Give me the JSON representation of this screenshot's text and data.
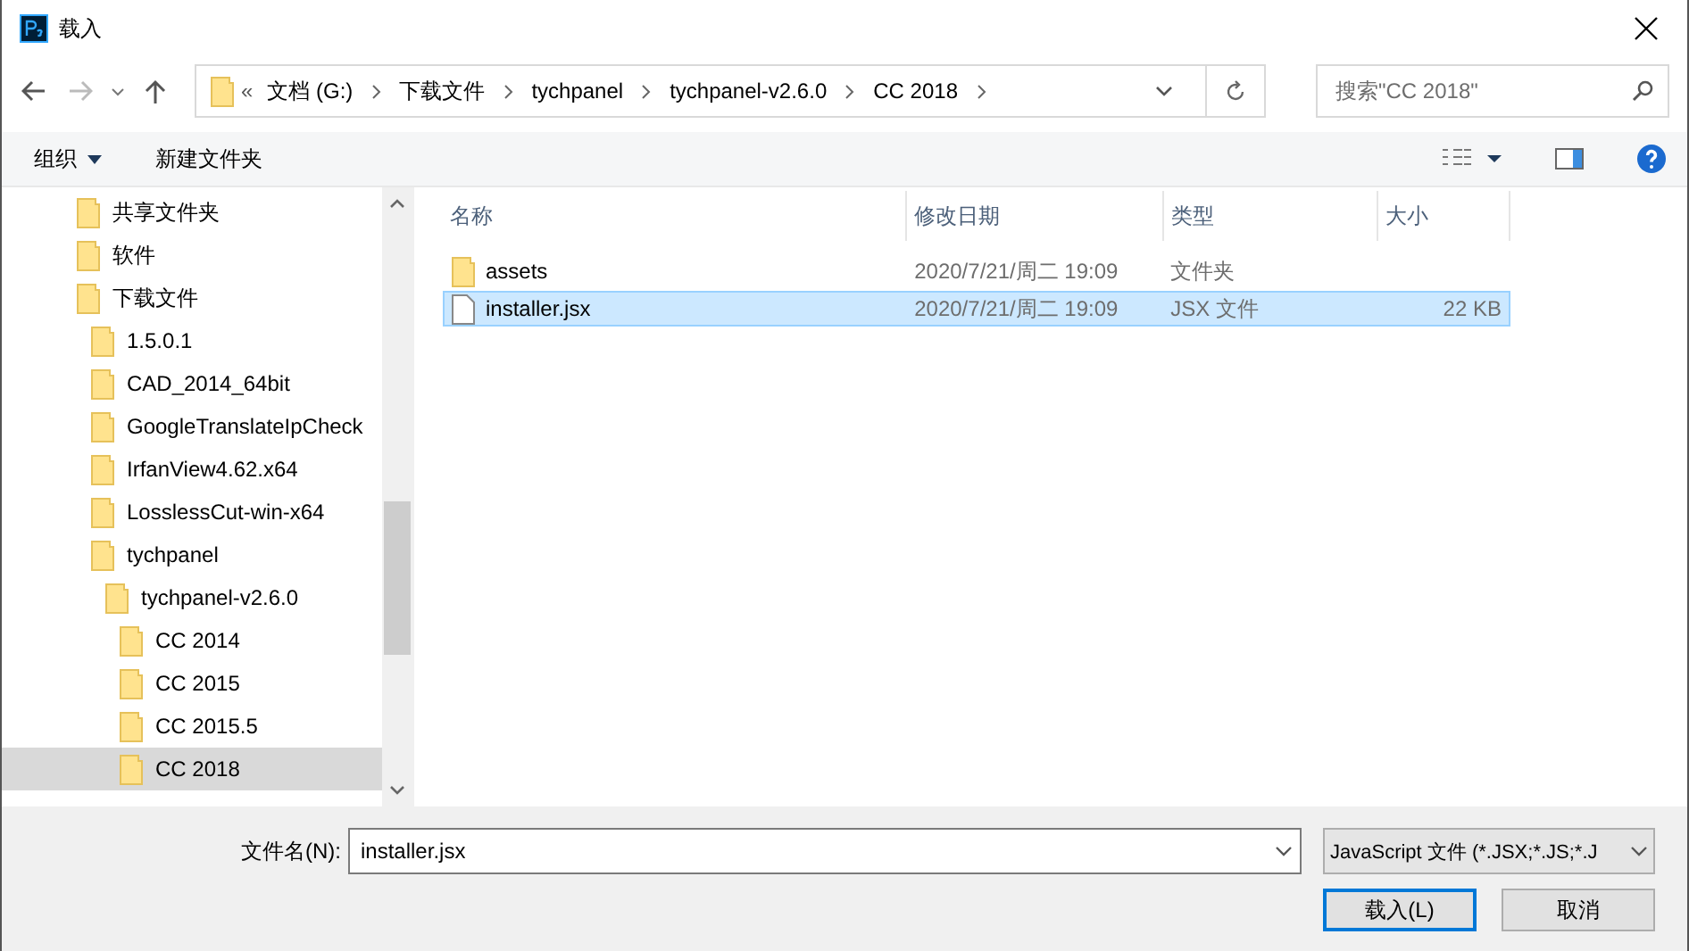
{
  "window": {
    "title": "载入"
  },
  "address": {
    "overflow": "«",
    "crumbs": [
      "文档 (G:)",
      "下载文件",
      "tychpanel",
      "tychpanel-v2.6.0",
      "CC 2018"
    ]
  },
  "search": {
    "placeholder": "搜索\"CC 2018\""
  },
  "toolbar": {
    "organize": "组织",
    "new_folder": "新建文件夹"
  },
  "tree": [
    {
      "label": "共享文件夹",
      "selected": false
    },
    {
      "label": "软件",
      "selected": false
    },
    {
      "label": "下载文件",
      "selected": false,
      "children": [
        {
          "label": "1.5.0.1",
          "selected": false
        },
        {
          "label": "CAD_2014_64bit",
          "selected": false
        },
        {
          "label": "GoogleTranslateIpCheck",
          "selected": false
        },
        {
          "label": "IrfanView4.62.x64",
          "selected": false
        },
        {
          "label": "LosslessCut-win-x64",
          "selected": false
        },
        {
          "label": "tychpanel",
          "selected": false,
          "children": [
            {
              "label": "tychpanel-v2.6.0",
              "selected": false,
              "children": [
                {
                  "label": "CC 2014",
                  "selected": false
                },
                {
                  "label": "CC 2015",
                  "selected": false
                },
                {
                  "label": "CC 2015.5",
                  "selected": false
                },
                {
                  "label": "CC 2018",
                  "selected": true
                }
              ]
            }
          ]
        }
      ]
    }
  ],
  "table": {
    "columns": [
      "名称",
      "修改日期",
      "类型",
      "大小"
    ],
    "rows": [
      {
        "kind": "folder",
        "name": "assets",
        "date": "2020/7/21/周二 19:09",
        "type": "文件夹",
        "selected": false
      },
      {
        "kind": "file",
        "name": "installer.jsx",
        "date": "2020/7/21/周二 19:09",
        "type": "JSX 文件",
        "size": "22 KB",
        "selected": true
      }
    ]
  },
  "footer": {
    "filename_label": "文件名(N):",
    "filename": "installer.jsx",
    "filter": "JavaScript 文件 (*.JSX;*.JS;*.J",
    "buttons": [
      "载入(L)",
      "取消"
    ]
  }
}
